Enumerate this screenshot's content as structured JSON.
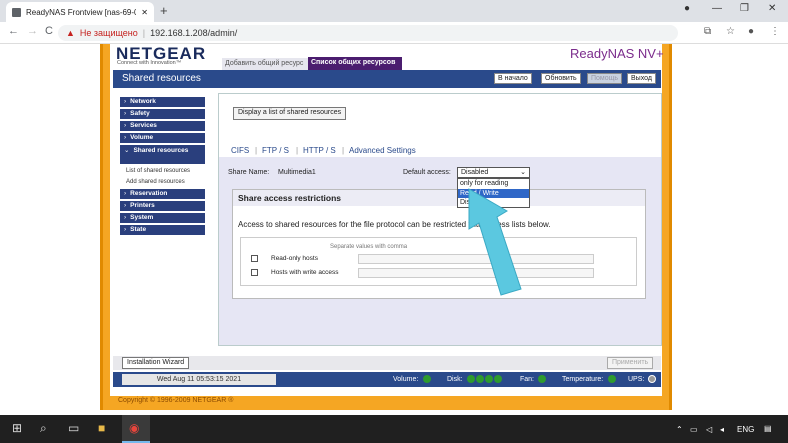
{
  "browser": {
    "tab_title": "ReadyNAS Frontview [nas-69-05]",
    "new_tab": "+",
    "minimize": "—",
    "restore": "❐",
    "close": "✕",
    "back": "←",
    "forward": "→",
    "reload": "C",
    "security_warning": "Не защищено",
    "url": "192.168.1.208/admin/"
  },
  "header": {
    "logo": "NETGEAR",
    "slogan": "Connect with Innovation™",
    "tab_add_share": "Добавить общий ресурс",
    "tab_share_list": "Список общих ресурсов",
    "product": "ReadyNAS NV+"
  },
  "titlebar": {
    "title": "Shared resources",
    "buttons": [
      "В начало",
      "Обновить",
      "Помощь",
      "Выход"
    ]
  },
  "nav": {
    "items": [
      "Network",
      "Safety",
      "Services",
      "Volume",
      "Shared resources",
      "Reservation",
      "Printers",
      "System",
      "State"
    ],
    "subitems": [
      "List of shared resources",
      "Add shared resources"
    ]
  },
  "main": {
    "display_button": "Display a list of shared resources",
    "protocol_tabs": [
      "CIFS",
      "FTP / S",
      "HTTP / S",
      "Advanced Settings"
    ],
    "share_name_label": "Share Name:",
    "share_name_value": "Multimedia1",
    "default_access_label": "Default access:",
    "default_access_value": "Disabled",
    "default_access_options": [
      "only for reading",
      "Read / Write",
      "Disabled"
    ],
    "default_access_highlighted": "Read / Write",
    "restrictions_title": "Share access restrictions",
    "restrictions_text": "Access to shared resources for the file protocol can be restricted with access lists below.",
    "separator_hint": "Separate values with comma",
    "readonly_hosts_label": "Read-only hosts",
    "write_hosts_label": "Hosts with write access"
  },
  "footer": {
    "wizard_button": "Installation Wizard",
    "apply_button": "Применить",
    "datetime": "Wed Aug 11 05:53:15 2021",
    "status": [
      "Volume:",
      "Disk:",
      "Fan:",
      "Temperature:",
      "UPS:"
    ],
    "copyright": "Copyright © 1996-2009 NETGEAR ®"
  },
  "taskbar": {
    "lang": "ENG"
  },
  "colors": {
    "frame": "#f5a623",
    "nav": "#2a3f7d",
    "titlebar": "#2a4a8b",
    "status_ok": "#2e9b2e"
  }
}
